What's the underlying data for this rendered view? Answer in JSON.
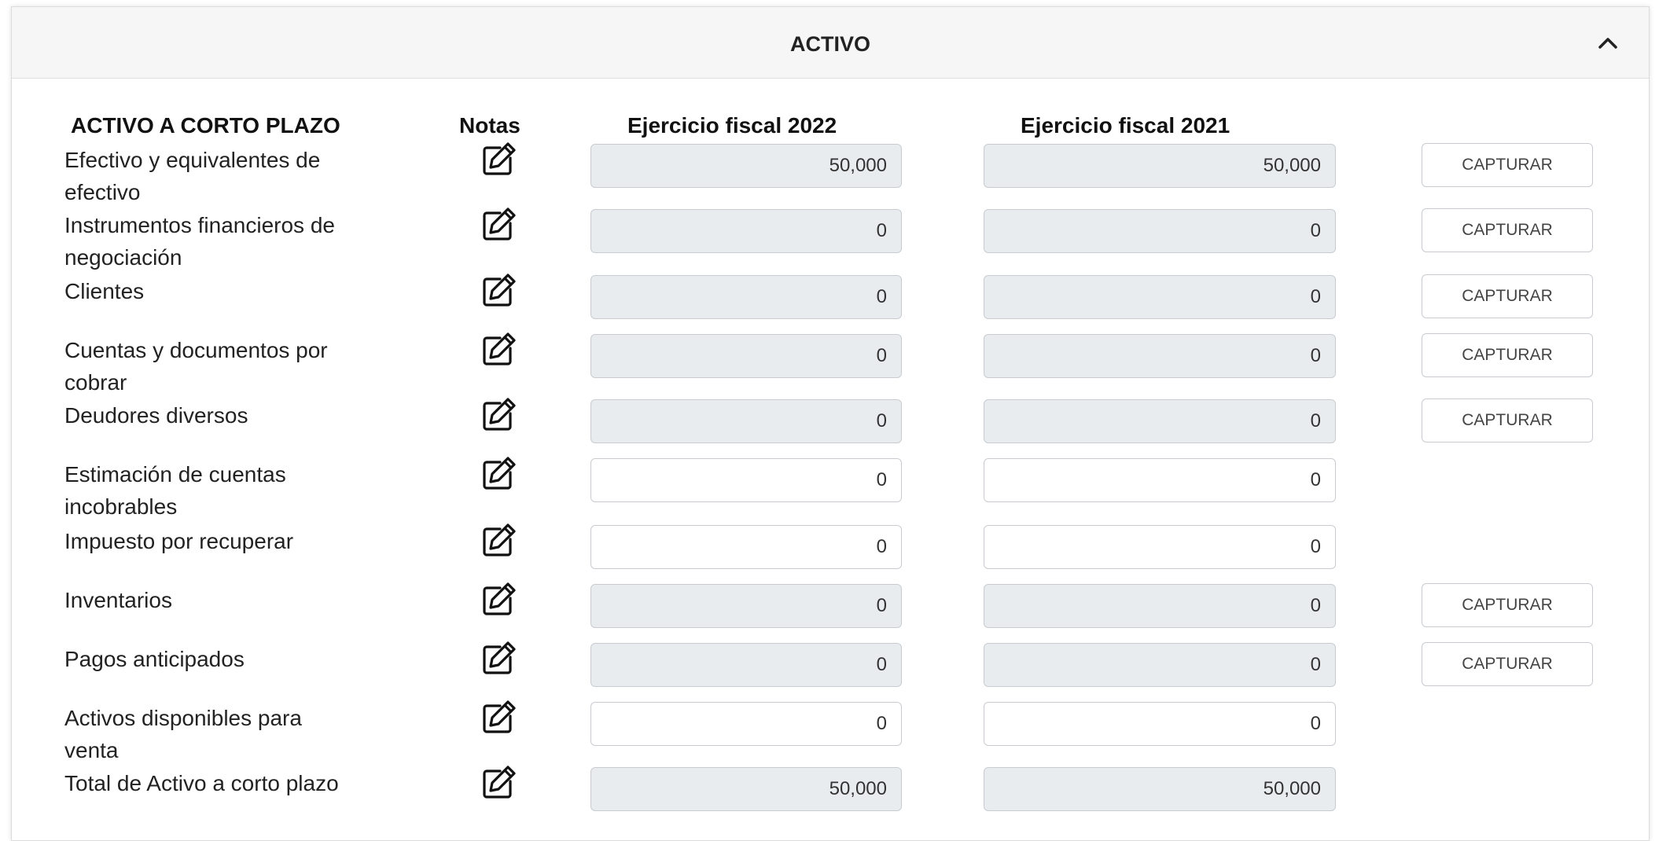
{
  "panel": {
    "title": "ACTIVO"
  },
  "icons": {
    "collapse": "chevron-up-icon",
    "edit": "edit-note-icon"
  },
  "colors": {
    "readonly_bg": "#e9ecef",
    "editable_bg": "#ffffff",
    "header_bg": "#f6f6f6"
  },
  "columns": {
    "section": "ACTIVO A CORTO PLAZO",
    "notes": "Notas",
    "fy2022": "Ejercicio fiscal 2022",
    "fy2021": "Ejercicio fiscal 2021"
  },
  "rows": [
    {
      "label": "Efectivo y equivalentes de efectivo",
      "fy2022": "50,000",
      "fy2021": "50,000",
      "editable": false,
      "capture": "CAPTURAR"
    },
    {
      "label": "Instrumentos financieros de negociación",
      "fy2022": "0",
      "fy2021": "0",
      "editable": false,
      "capture": "CAPTURAR"
    },
    {
      "label": "Clientes",
      "fy2022": "0",
      "fy2021": "0",
      "editable": false,
      "capture": "CAPTURAR"
    },
    {
      "label": "Cuentas y documentos por cobrar",
      "fy2022": "0",
      "fy2021": "0",
      "editable": false,
      "capture": "CAPTURAR"
    },
    {
      "label": "Deudores diversos",
      "fy2022": "0",
      "fy2021": "0",
      "editable": false,
      "capture": "CAPTURAR"
    },
    {
      "label": "Estimación de cuentas incobrables",
      "fy2022": "0",
      "fy2021": "0",
      "editable": true,
      "capture": null
    },
    {
      "label": "Impuesto por recuperar",
      "fy2022": "0",
      "fy2021": "0",
      "editable": true,
      "capture": null
    },
    {
      "label": "Inventarios",
      "fy2022": "0",
      "fy2021": "0",
      "editable": false,
      "capture": "CAPTURAR"
    },
    {
      "label": "Pagos anticipados",
      "fy2022": "0",
      "fy2021": "0",
      "editable": false,
      "capture": "CAPTURAR"
    },
    {
      "label": "Activos disponibles para venta",
      "fy2022": "0",
      "fy2021": "0",
      "editable": true,
      "capture": null
    },
    {
      "label": "Total de Activo a corto plazo",
      "fy2022": "50,000",
      "fy2021": "50,000",
      "editable": false,
      "capture": null
    }
  ]
}
